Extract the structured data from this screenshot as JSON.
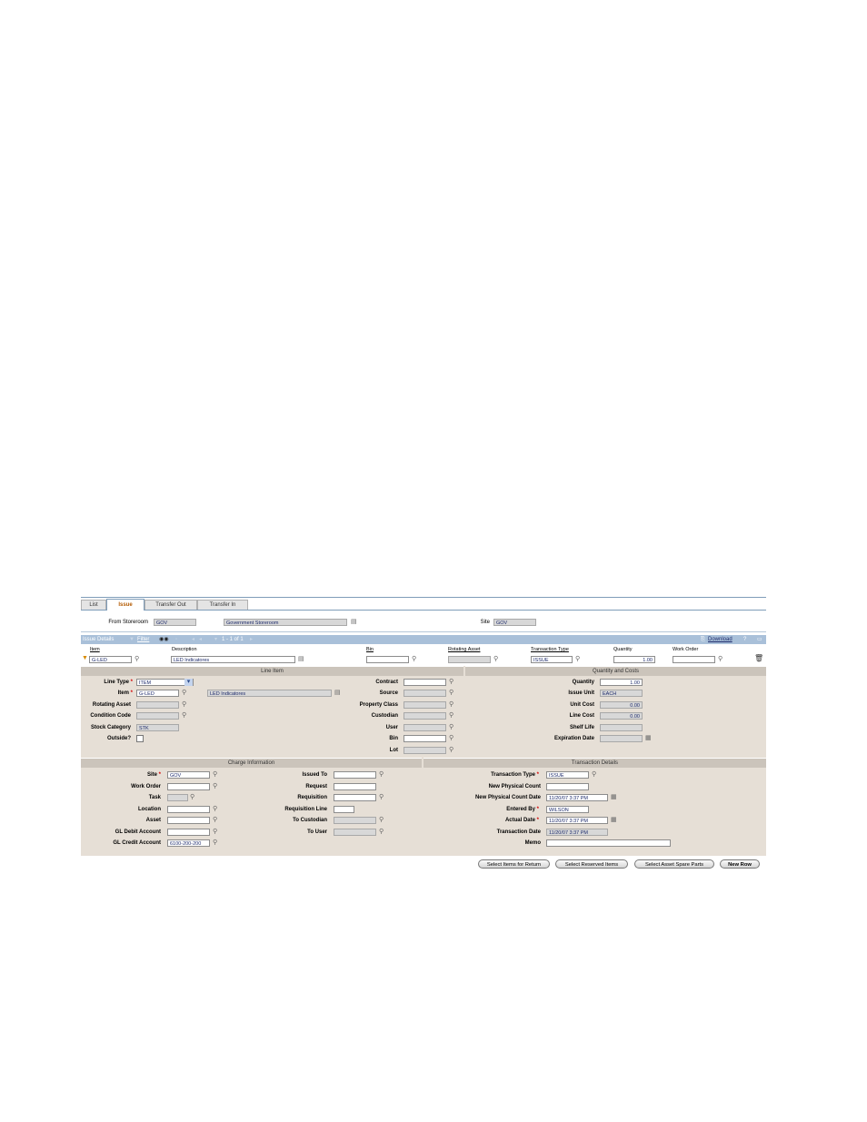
{
  "tabs": [
    "List",
    "Issue",
    "Transfer Out",
    "Transfer In"
  ],
  "header": {
    "from_storeroom_label": "From Storeroom",
    "from_storeroom_value": "GOV",
    "storeroom_desc": "Government Storeroom",
    "site_label": "Site",
    "site_value": "GOV"
  },
  "issue_bar": {
    "title": "Issue Details",
    "filter": "Filter",
    "paging": "1 - 1 of 1",
    "download": "Download",
    "help": "?"
  },
  "columns": [
    "Item",
    "Description",
    "Bin",
    "Rotating Asset",
    "Transaction Type",
    "Quantity",
    "Work Order"
  ],
  "row": {
    "item": "G-LED",
    "description": "LED Indicatores",
    "bin": "",
    "rotating_asset": "",
    "transaction_type": "ISSUE",
    "quantity": "1.00",
    "work_order": ""
  },
  "sections": {
    "line_item": "Line Item",
    "quantity_costs": "Quantity and Costs",
    "charge_info": "Charge Information",
    "transaction_details": "Transaction Details"
  },
  "line_item": {
    "line_type_label": "Line Type",
    "line_type_value": "ITEM",
    "item_label": "Item",
    "item_value": "G-LED",
    "item_desc": "LED Indicatores",
    "rotating_asset_label": "Rotating Asset",
    "condition_code_label": "Condition Code",
    "stock_category_label": "Stock Category",
    "stock_category_value": "STK",
    "outside_label": "Outside?",
    "contract_label": "Contract",
    "source_label": "Source",
    "property_class_label": "Property Class",
    "custodian_label": "Custodian",
    "user_label": "User",
    "bin_label": "Bin",
    "lot_label": "Lot"
  },
  "qty_costs": {
    "quantity_label": "Quantity",
    "quantity_value": "1.00",
    "issue_unit_label": "Issue Unit",
    "issue_unit_value": "EACH",
    "unit_cost_label": "Unit Cost",
    "unit_cost_value": "0.00",
    "line_cost_label": "Line Cost",
    "line_cost_value": "0.00",
    "shelf_life_label": "Shelf Life",
    "expiration_label": "Expiration Date"
  },
  "charge": {
    "site_label": "Site",
    "site_value": "GOV",
    "work_order_label": "Work Order",
    "task_label": "Task",
    "location_label": "Location",
    "asset_label": "Asset",
    "gl_debit_label": "GL Debit Account",
    "gl_credit_label": "GL Credit Account",
    "gl_credit_value": "6100-200-200",
    "issued_to_label": "Issued To",
    "request_label": "Request",
    "requisition_label": "Requisition",
    "requisition_line_label": "Requisition Line",
    "to_custodian_label": "To Custodian",
    "to_user_label": "To User"
  },
  "transaction": {
    "type_label": "Transaction Type",
    "type_value": "ISSUE",
    "new_physical_count_label": "New Physical Count",
    "new_physical_count_date_label": "New Physical Count Date",
    "new_physical_count_date_value": "11/20/07 3:37 PM",
    "entered_by_label": "Entered By",
    "entered_by_value": "WILSON",
    "actual_date_label": "Actual Date",
    "actual_date_value": "11/20/07 3:37 PM",
    "transaction_date_label": "Transaction Date",
    "transaction_date_value": "11/20/07 3:37 PM",
    "memo_label": "Memo"
  },
  "buttons": {
    "select_return": "Select Items for Return",
    "select_reserved": "Select Reserved Items",
    "select_spare": "Select Asset Spare Parts",
    "new_row": "New Row"
  }
}
